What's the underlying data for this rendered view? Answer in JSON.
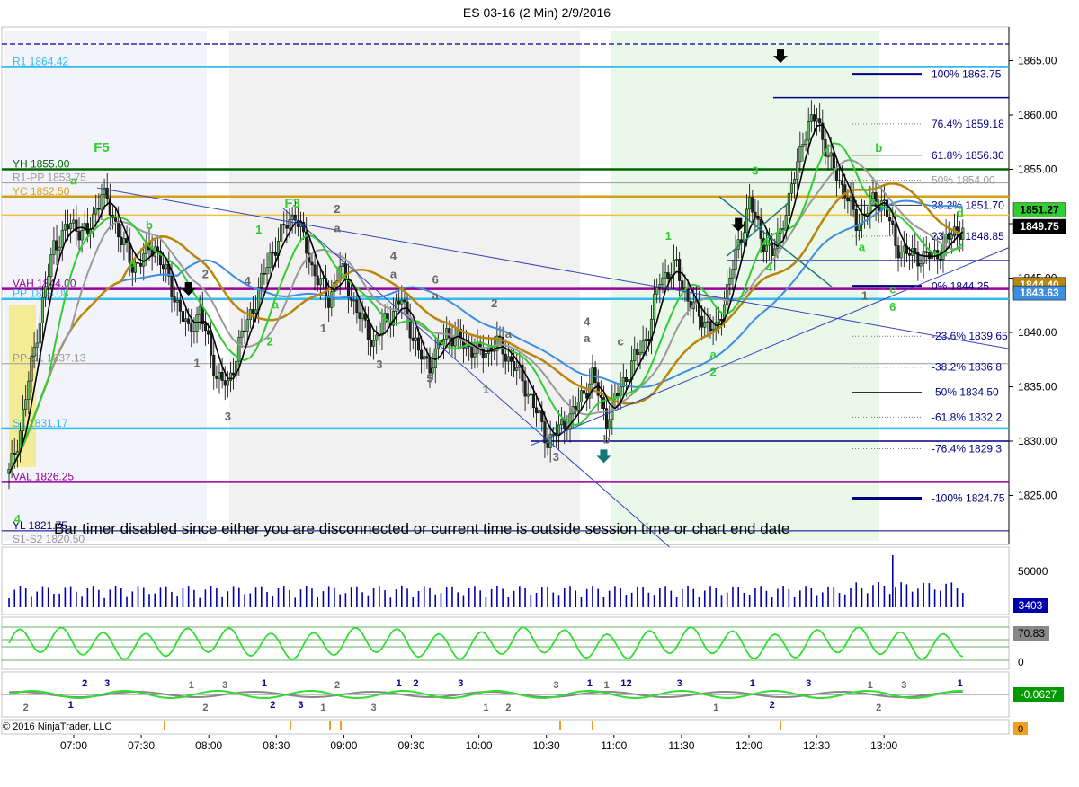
{
  "title": "ES 03-16 (2 Min)  2/9/2016",
  "copyright": "© 2016 NinjaTrader, LLC",
  "status_message": "Bar timer disabled since either you are disconnected or current time is outside session time or chart end date",
  "colors": {
    "up_candle": "#4caf50",
    "down_candle": "#000000",
    "ema_fast": "#000000",
    "ema_green": "#33cc33",
    "sma_gray": "#999999",
    "sma_gold": "#b8860b",
    "sma_blue": "#3d8ee0",
    "pivot_cyan": "#33bbee",
    "va_purple": "#990099",
    "fib_blue": "#000080",
    "day_high_green": "#006600",
    "yc_gold": "#d4a017"
  },
  "chart_data": [
    {
      "type": "candlestick",
      "title": "ES 03-16 (2 Min)  2/9/2016",
      "y_ticks": [
        1825.0,
        1830.0,
        1835.0,
        1840.0,
        1845.0,
        1850.0,
        1855.0,
        1860.0,
        1865.0
      ],
      "ylim": [
        1820.0,
        1867.0
      ],
      "x_ticks": [
        "07:00",
        "07:30",
        "08:00",
        "08:30",
        "09:00",
        "09:30",
        "10:00",
        "10:30",
        "11:00",
        "11:30",
        "12:00",
        "12:30",
        "13:00"
      ],
      "price_badges": [
        {
          "value": "1851.27",
          "color": "#33cc33",
          "price": 1851.27
        },
        {
          "value": "1849.75",
          "color": "#000000",
          "price": 1849.75
        },
        {
          "value": "1844.40",
          "color": "#b8860b",
          "price": 1844.4
        },
        {
          "value": "1843.63",
          "color": "#3d8ee0",
          "price": 1843.63
        }
      ],
      "levels": [
        {
          "label": "R1 1864.42",
          "price": 1864.42,
          "color": "#33bbee"
        },
        {
          "label": "YH 1855.00",
          "price": 1855.0,
          "color": "#006600"
        },
        {
          "label": "R1-PP 1853.75",
          "price": 1853.75,
          "color": "#999999"
        },
        {
          "label": "YC 1852.50",
          "price": 1852.5,
          "color": "#d4a017"
        },
        {
          "label": "VAH 1844.00",
          "price": 1844.0,
          "color": "#990099"
        },
        {
          "label": "PP 1843.08",
          "price": 1843.08,
          "color": "#33bbee"
        },
        {
          "label": "PP-S1 1837.13",
          "price": 1837.13,
          "color": "#999999"
        },
        {
          "label": "S1 1831.17",
          "price": 1831.17,
          "color": "#33bbee"
        },
        {
          "label": "VAL 1826.25",
          "price": 1826.25,
          "color": "#990099"
        },
        {
          "label": "YL 1821.75",
          "price": 1821.75,
          "color": "#000080"
        },
        {
          "label": "S1-S2 1820.50",
          "price": 1820.5,
          "color": "#999999"
        }
      ],
      "fib_levels": [
        {
          "pct": "100%",
          "value": "1863.75",
          "price": 1863.75
        },
        {
          "pct": "76.4%",
          "value": "1859.18",
          "price": 1859.18
        },
        {
          "pct": "61.8%",
          "value": "1856.30",
          "price": 1856.3
        },
        {
          "pct": "50%",
          "value": "1854.00",
          "price": 1854.0
        },
        {
          "pct": "38.2%",
          "value": "1851.70",
          "price": 1851.7
        },
        {
          "pct": "23.6%",
          "value": "1848.85",
          "price": 1848.85
        },
        {
          "pct": "0%",
          "value": "1844.25",
          "price": 1844.25
        },
        {
          "pct": "-23.6%",
          "value": "1839.65",
          "price": 1839.65
        },
        {
          "pct": "-38.2%",
          "value": "1836.8",
          "price": 1836.8
        },
        {
          "pct": "-50%",
          "value": "1834.50",
          "price": 1834.5
        },
        {
          "pct": "-61.8%",
          "value": "1832.2",
          "price": 1832.2
        },
        {
          "pct": "-76.4%",
          "value": "1829.3",
          "price": 1829.3
        },
        {
          "pct": "-100%",
          "value": "1824.75",
          "price": 1824.75
        }
      ],
      "markers": [
        {
          "text": "F5",
          "t": 33,
          "price": 1856.6,
          "color": "#33cc33"
        },
        {
          "text": "F3",
          "t": 101,
          "price": 1851.5,
          "color": "#33cc33"
        },
        {
          "text": "a",
          "t": 23,
          "price": 1853.6,
          "color": "#33cc33"
        },
        {
          "text": "b",
          "t": 50,
          "price": 1849.5,
          "color": "#33cc33"
        },
        {
          "text": "a",
          "t": 44,
          "price": 1846.0,
          "color": "#33cc33"
        },
        {
          "text": "1",
          "t": 89,
          "price": 1849.1,
          "color": "#33cc33"
        },
        {
          "text": "2",
          "t": 93,
          "price": 1838.8,
          "color": "#33cc33"
        },
        {
          "text": "a",
          "t": 95,
          "price": 1842.2,
          "color": "#33cc33"
        },
        {
          "text": "4",
          "t": 3,
          "price": 1822.5,
          "color": "#33cc33"
        },
        {
          "text": "1",
          "t": 235,
          "price": 1848.5,
          "color": "#33cc33"
        },
        {
          "text": "2",
          "t": 251,
          "price": 1836.0,
          "color": "#33cc33"
        },
        {
          "text": "a",
          "t": 251,
          "price": 1837.6,
          "color": "#33cc33"
        },
        {
          "text": "3",
          "t": 266,
          "price": 1854.5,
          "color": "#33cc33"
        },
        {
          "text": "4",
          "t": 271,
          "price": 1845.6,
          "color": "#33cc33"
        },
        {
          "text": "a",
          "t": 270,
          "price": 1848.0,
          "color": "#33cc33"
        },
        {
          "text": "b",
          "t": 310,
          "price": 1856.6,
          "color": "#33cc33"
        },
        {
          "text": "a",
          "t": 304,
          "price": 1847.5,
          "color": "#33cc33"
        },
        {
          "text": "6",
          "t": 315,
          "price": 1842.0,
          "color": "#33cc33"
        },
        {
          "text": "c",
          "t": 315,
          "price": 1843.6,
          "color": "#33cc33"
        },
        {
          "text": "d",
          "t": 339,
          "price": 1850.6,
          "color": "#33cc33"
        },
        {
          "text": "2",
          "t": 117,
          "price": 1851.0,
          "color": "#666666"
        },
        {
          "text": "a",
          "t": 117,
          "price": 1849.2,
          "color": "#666666"
        },
        {
          "text": "4",
          "t": 137,
          "price": 1846.7,
          "color": "#666666"
        },
        {
          "text": "a",
          "t": 137,
          "price": 1845.0,
          "color": "#666666"
        },
        {
          "text": "6",
          "t": 152,
          "price": 1844.5,
          "color": "#666666"
        },
        {
          "text": "a",
          "t": 152,
          "price": 1843.0,
          "color": "#666666"
        },
        {
          "text": "2",
          "t": 173,
          "price": 1842.3,
          "color": "#666666"
        },
        {
          "text": "1",
          "t": 112,
          "price": 1840.0,
          "color": "#666666"
        },
        {
          "text": "3",
          "t": 132,
          "price": 1836.7,
          "color": "#666666"
        },
        {
          "text": "5",
          "t": 150,
          "price": 1835.4,
          "color": "#666666"
        },
        {
          "text": "1",
          "t": 170,
          "price": 1834.4,
          "color": "#666666"
        },
        {
          "text": "a",
          "t": 178,
          "price": 1839.5,
          "color": "#666666"
        },
        {
          "text": "3",
          "t": 78,
          "price": 1831.9,
          "color": "#666666"
        },
        {
          "text": "1",
          "t": 67,
          "price": 1836.8,
          "color": "#666666"
        },
        {
          "text": "3",
          "t": 195,
          "price": 1828.2,
          "color": "#666666"
        },
        {
          "text": "4",
          "t": 206,
          "price": 1840.6,
          "color": "#666666"
        },
        {
          "text": "a",
          "t": 206,
          "price": 1839.1,
          "color": "#666666"
        },
        {
          "text": "c",
          "t": 218,
          "price": 1838.8,
          "color": "#666666"
        },
        {
          "text": "b",
          "t": 213,
          "price": 1829.8,
          "color": "#666666"
        },
        {
          "text": "2",
          "t": 70,
          "price": 1845.0,
          "color": "#666666"
        },
        {
          "text": "4",
          "t": 85,
          "price": 1844.4,
          "color": "#666666"
        },
        {
          "text": "1",
          "t": 305,
          "price": 1843.0,
          "color": "#666666"
        }
      ],
      "volume_axis_tick": "50000",
      "volume_value": "3403",
      "oscillator_ticks": [
        "100",
        "0"
      ],
      "oscillator_value": "70.83",
      "momentum_value": "-0.0627",
      "bottom_value": "0",
      "momentum_labels": [
        {
          "text": "1",
          "t": 22,
          "color": "#000099"
        },
        {
          "text": "3",
          "t": 35,
          "color": "#000099"
        },
        {
          "text": "2",
          "t": 27,
          "color": "#000099"
        },
        {
          "text": "1",
          "t": 91,
          "color": "#000099"
        },
        {
          "text": "3",
          "t": 104,
          "color": "#000099"
        },
        {
          "text": "2",
          "t": 94,
          "color": "#000099"
        },
        {
          "text": "1",
          "t": 139,
          "color": "#000099"
        },
        {
          "text": "2",
          "t": 145,
          "color": "#000099"
        },
        {
          "text": "3",
          "t": 161,
          "color": "#000099"
        },
        {
          "text": "1",
          "t": 207,
          "color": "#000099"
        },
        {
          "text": "1",
          "t": 219,
          "color": "#000099"
        },
        {
          "text": "2",
          "t": 221,
          "color": "#000099"
        },
        {
          "text": "3",
          "t": 239,
          "color": "#000099"
        },
        {
          "text": "1",
          "t": 265,
          "color": "#000099"
        },
        {
          "text": "2",
          "t": 272,
          "color": "#000099"
        },
        {
          "text": "3",
          "t": 285,
          "color": "#000099"
        },
        {
          "text": "1",
          "t": 339,
          "color": "#000099"
        },
        {
          "text": "2",
          "t": 70,
          "color": "#666666"
        },
        {
          "text": "1",
          "t": 65,
          "color": "#666666"
        },
        {
          "text": "3",
          "t": 77,
          "color": "#666666"
        },
        {
          "text": "2",
          "t": 117,
          "color": "#666666"
        },
        {
          "text": "1",
          "t": 112,
          "color": "#666666"
        },
        {
          "text": "3",
          "t": 130,
          "color": "#666666"
        },
        {
          "text": "2",
          "t": 178,
          "color": "#666666"
        },
        {
          "text": "1",
          "t": 170,
          "color": "#666666"
        },
        {
          "text": "3",
          "t": 195,
          "color": "#666666"
        },
        {
          "text": "1",
          "t": 213,
          "color": "#666666"
        },
        {
          "text": "1",
          "t": 252,
          "color": "#666666"
        },
        {
          "text": "2",
          "t": 310,
          "color": "#666666"
        },
        {
          "text": "1",
          "t": 307,
          "color": "#666666"
        },
        {
          "text": "3",
          "t": 319,
          "color": "#666666"
        },
        {
          "text": "2",
          "t": 6,
          "color": "#666666"
        }
      ]
    }
  ]
}
